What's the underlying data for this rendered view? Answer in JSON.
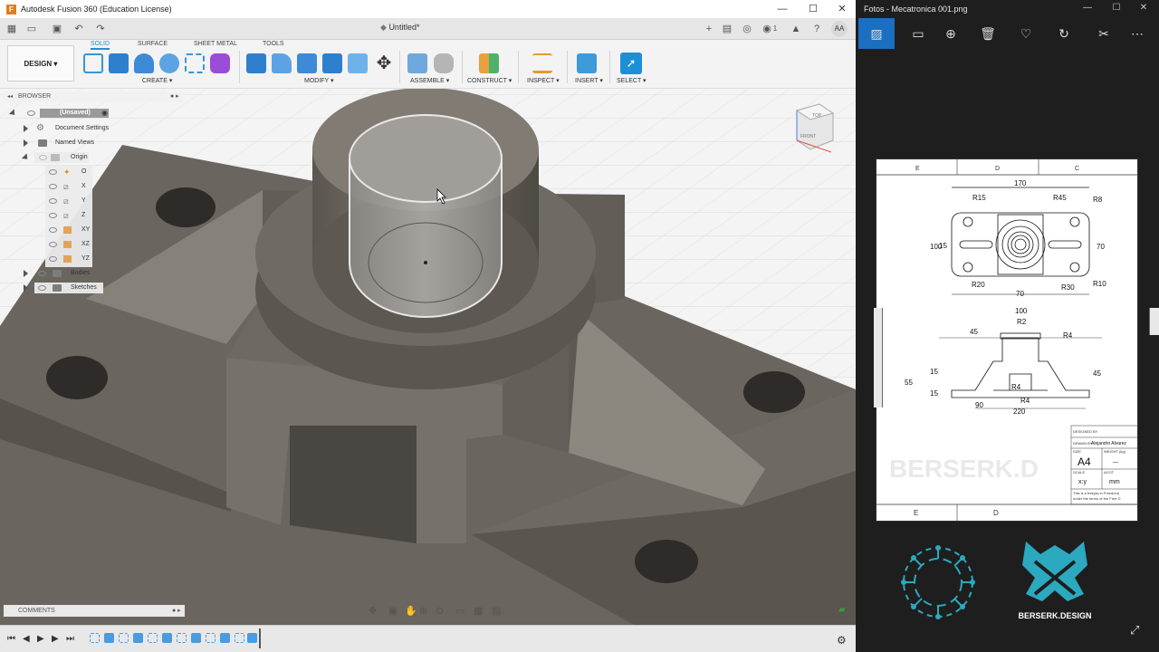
{
  "fusion": {
    "window_title": "Autodesk Fusion 360 (Education License)",
    "document_tab": "Untitled*",
    "user_initials": "AA",
    "job_count": "1",
    "workspace_button": "DESIGN",
    "workspace_tabs": [
      "SOLID",
      "SURFACE",
      "SHEET METAL",
      "TOOLS"
    ],
    "tool_groups": [
      "CREATE",
      "MODIFY",
      "ASSEMBLE",
      "CONSTRUCT",
      "INSPECT",
      "INSERT",
      "SELECT"
    ],
    "browser": {
      "header": "BROWSER",
      "items": [
        {
          "label": "(Unsaved)"
        },
        {
          "label": "Document Settings"
        },
        {
          "label": "Named Views"
        },
        {
          "label": "Origin"
        },
        {
          "label": "O"
        },
        {
          "label": "X"
        },
        {
          "label": "Y"
        },
        {
          "label": "Z"
        },
        {
          "label": "XY"
        },
        {
          "label": "XZ"
        },
        {
          "label": "YZ"
        },
        {
          "label": "Bodies"
        },
        {
          "label": "Sketches"
        }
      ]
    },
    "viewcube": {
      "top": "TOP",
      "front": "FRONT"
    },
    "comments": "COMMENTS"
  },
  "photos": {
    "window_title": "Fotos - Mecatronica 001.png",
    "drawing": {
      "zone_top": [
        "E",
        "D",
        "C"
      ],
      "zone_bottom": [
        "E",
        "D"
      ],
      "dims_top": [
        "170",
        "R15",
        "R45",
        "R8",
        "100",
        "15",
        "70",
        "R20",
        "70",
        "R30",
        "R10"
      ],
      "dims_front": [
        "100",
        "R2",
        "45",
        "R4",
        "55",
        "15",
        "15",
        "R4",
        "R4",
        "45",
        "90",
        "220"
      ],
      "title_block": {
        "designed_by": "DESIGNED BY",
        "drawn_by": "DRAWN BY",
        "drawn_name": "Alejandro Alvarez",
        "size_label": "SIZE",
        "size": "A4",
        "weight": "WEIGHT (kg)",
        "weight_value": "—",
        "scale_label": "SCALE",
        "scale": "x:y",
        "units_label": "ACOT",
        "units": "mm",
        "license_1": "This is a free(as in Freedom)",
        "license_2": "under the terms of the Free D"
      },
      "watermark": "BERSERK.D"
    },
    "brand": "BERSERK.DESIGN"
  }
}
